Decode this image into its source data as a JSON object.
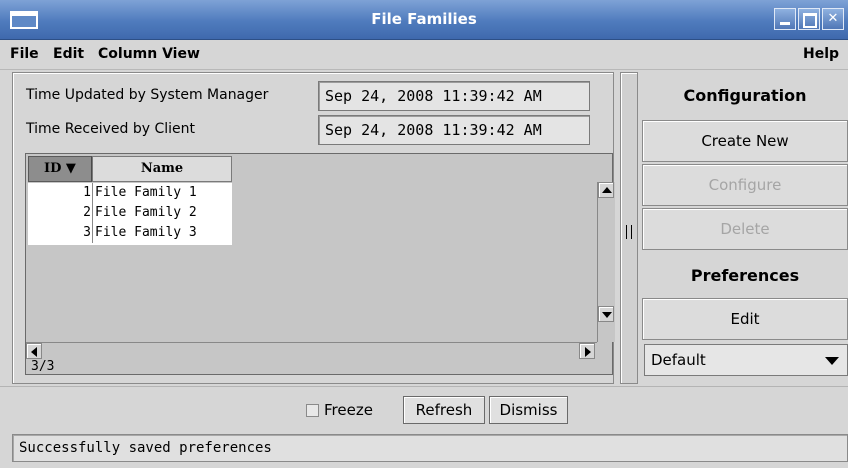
{
  "window": {
    "title": "File Families"
  },
  "menubar": {
    "file": "File",
    "edit": "Edit",
    "column_view": "Column View",
    "help": "Help"
  },
  "times": {
    "updated_label": "Time Updated by System Manager",
    "updated_value": "Sep 24, 2008 11:39:42 AM",
    "received_label": "Time Received by Client",
    "received_value": "Sep 24, 2008 11:39:42 AM"
  },
  "table": {
    "columns": [
      "ID ▼",
      "Name"
    ],
    "rows": [
      {
        "id": "1",
        "name": "File Family 1"
      },
      {
        "id": "2",
        "name": "File Family 2"
      },
      {
        "id": "3",
        "name": "File Family 3"
      }
    ],
    "count": "3/3"
  },
  "right_panel": {
    "configuration_heading": "Configuration",
    "create_new": "Create New",
    "configure": "Configure",
    "delete": "Delete",
    "preferences_heading": "Preferences",
    "edit": "Edit",
    "preference_select": "Default"
  },
  "bottom": {
    "freeze_label": "Freeze",
    "freeze_checked": false,
    "refresh": "Refresh",
    "dismiss": "Dismiss"
  },
  "status": {
    "message": "Successfully saved preferences"
  }
}
